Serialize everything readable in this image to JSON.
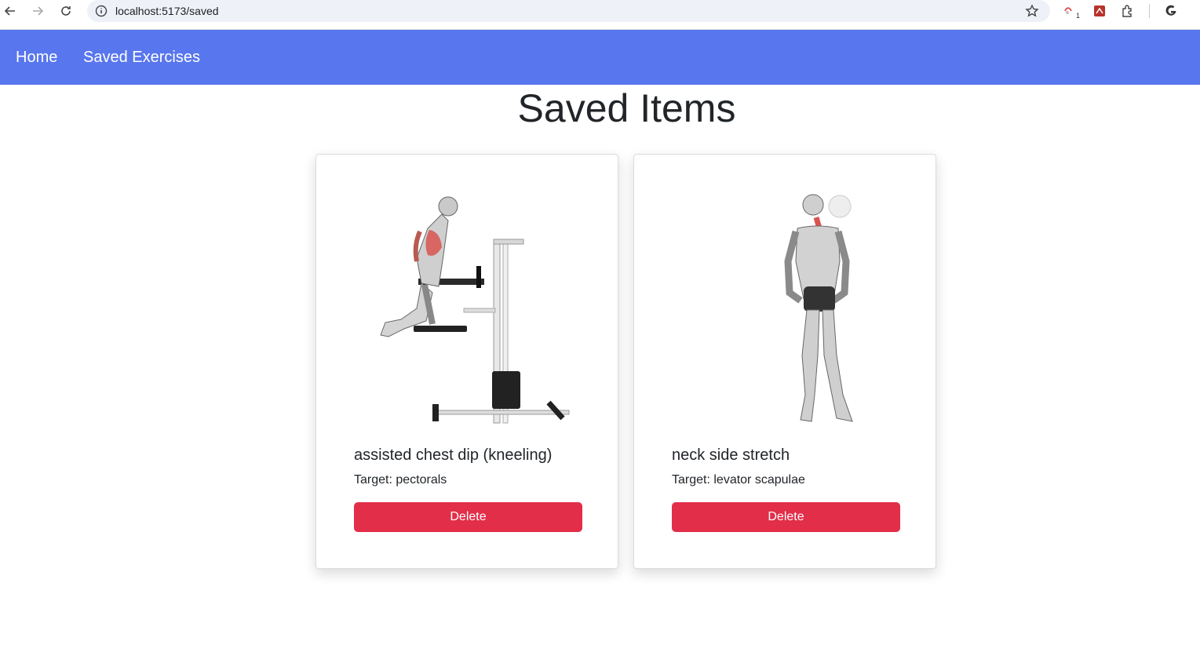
{
  "browser": {
    "url": "localhost:5173/saved",
    "extension_badge": "1"
  },
  "nav": {
    "home_label": "Home",
    "saved_label": "Saved Exercises",
    "background": "#5876ed"
  },
  "page": {
    "title": "Saved Items"
  },
  "cards": [
    {
      "name": "assisted chest dip (kneeling)",
      "target": "Target: pectorals",
      "delete_label": "Delete",
      "image": "kneeling-dip-figure"
    },
    {
      "name": "neck side stretch",
      "target": "Target: levator scapulae",
      "delete_label": "Delete",
      "image": "standing-neck-stretch-figure"
    }
  ],
  "colors": {
    "delete_button": "#e22e49",
    "muscle_highlight": "#d9534f"
  }
}
